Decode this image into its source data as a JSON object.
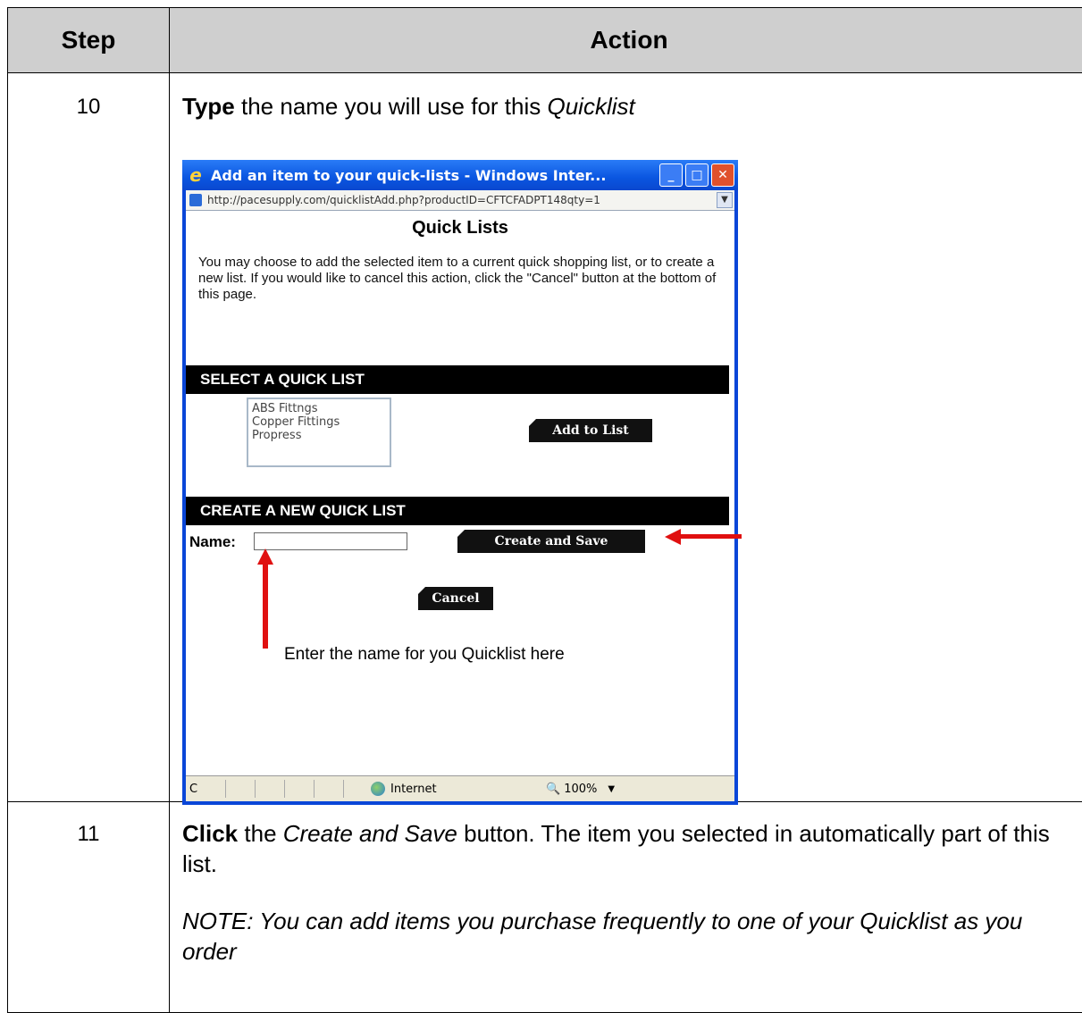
{
  "table": {
    "headers": {
      "step": "Step",
      "action": "Action"
    },
    "rows": [
      {
        "step": "10",
        "instruction": {
          "bold": "Type",
          "text": " the name you will use for this ",
          "italic": "Quicklist"
        }
      },
      {
        "step": "11",
        "instruction": {
          "bold": "Click",
          "text1": " the ",
          "italic": "Create and Save",
          "text2": " button. The item you selected in automatically part of this list."
        },
        "note": "NOTE: You can add items you purchase frequently to one of your Quicklist as you order"
      }
    ]
  },
  "window": {
    "title": "Add an item to your quick-lists - Windows Inter...",
    "address": "http://pacesupply.com/quicklistAdd.php?productID=CFTCFADPT148qty=1",
    "page_title": "Quick Lists",
    "intro": "You may choose to add the selected item to a current quick shopping list, or to create a new list. If you would like to cancel this action, click the \"Cancel\" button at the bottom of this page.",
    "select_header": "SELECT A QUICK LIST",
    "lists": [
      "ABS Fittngs",
      "Copper Fittings",
      "Propress"
    ],
    "add_button": "Add to List",
    "create_header": "CREATE A NEW QUICK LIST",
    "name_label": "Name:",
    "name_value": "",
    "create_button": "Create and Save",
    "cancel_button": "Cancel",
    "status_left": "C",
    "status_zone": "Internet",
    "status_zoom": "100%"
  },
  "callout": "Enter the name for you Quicklist here"
}
